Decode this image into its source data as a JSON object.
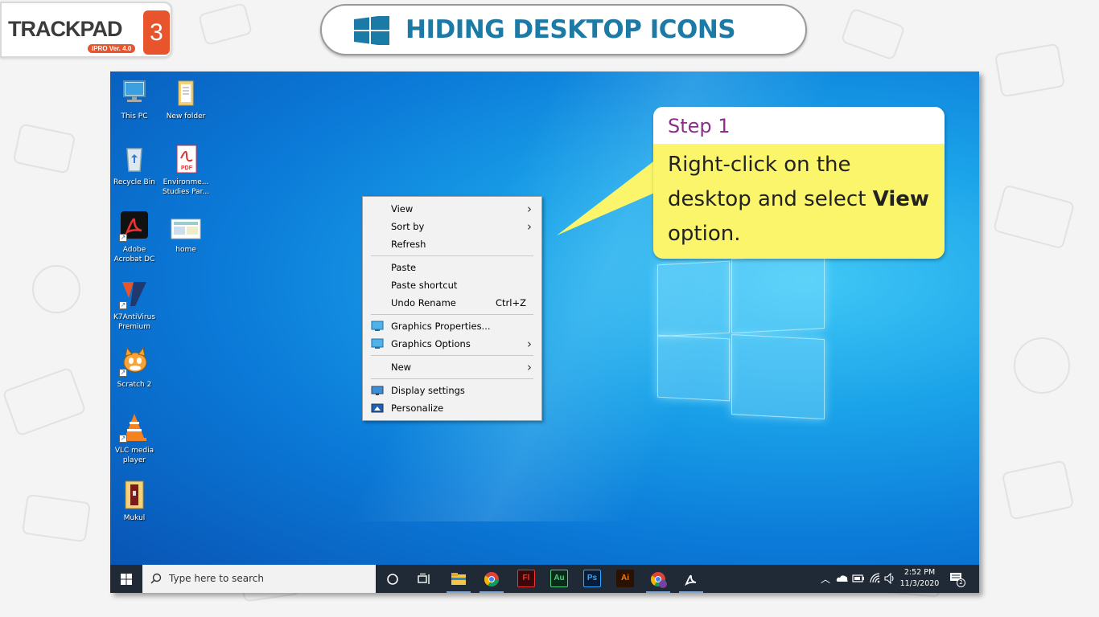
{
  "brand": {
    "name": "TRACKPAD",
    "version": "iPRO Ver. 4.0",
    "number": "3"
  },
  "banner": {
    "title": "HIDING DESKTOP ICONS"
  },
  "desktop_icons": [
    {
      "label": "This PC",
      "icon": "this-pc-icon"
    },
    {
      "label": "New folder",
      "icon": "folder-icon"
    },
    {
      "label": "Recycle Bin",
      "icon": "recycle-bin-icon"
    },
    {
      "label": "Environme... Studies Par...",
      "icon": "pdf-file-icon"
    },
    {
      "label": "Adobe Acrobat DC",
      "icon": "acrobat-icon"
    },
    {
      "label": "home",
      "icon": "image-file-icon"
    },
    {
      "label": "K7AntiVirus Premium",
      "icon": "k7-antivirus-icon"
    },
    {
      "label": "Scratch 2",
      "icon": "scratch-icon"
    },
    {
      "label": "VLC media player",
      "icon": "vlc-icon"
    },
    {
      "label": "Mukul",
      "icon": "archive-icon"
    }
  ],
  "context_menu": {
    "items": [
      {
        "label": "View",
        "submenu": true
      },
      {
        "label": "Sort by",
        "submenu": true
      },
      {
        "label": "Refresh"
      },
      {
        "label": "Paste"
      },
      {
        "label": "Paste shortcut"
      },
      {
        "label": "Undo Rename",
        "shortcut": "Ctrl+Z"
      },
      {
        "label": "Graphics Properties...",
        "icon": "graphics-icon"
      },
      {
        "label": "Graphics Options",
        "icon": "graphics-icon",
        "submenu": true
      },
      {
        "label": "New",
        "submenu": true
      },
      {
        "label": "Display settings",
        "icon": "display-icon"
      },
      {
        "label": "Personalize",
        "icon": "personalize-icon"
      }
    ]
  },
  "callout": {
    "heading": "Step 1",
    "text_before": "Right-click on the desktop and select ",
    "bold": "View",
    "text_after": " option."
  },
  "taskbar": {
    "search_placeholder": "Type here to search",
    "apps": [
      {
        "name": "cortana-icon"
      },
      {
        "name": "task-view-icon"
      },
      {
        "name": "file-explorer-icon"
      },
      {
        "name": "chrome-icon"
      },
      {
        "name": "flash-icon",
        "text": "Fl"
      },
      {
        "name": "audition-icon",
        "text": "Au"
      },
      {
        "name": "photoshop-icon",
        "text": "Ps"
      },
      {
        "name": "illustrator-icon",
        "text": "Ai"
      },
      {
        "name": "chrome-profile-icon"
      },
      {
        "name": "acrobat-taskbar-icon"
      }
    ],
    "time": "2:52 PM",
    "date": "11/3/2020",
    "notifications": "2"
  },
  "colors": {
    "banner_title": "#1c7aa6",
    "brand_orange": "#e8542b",
    "callout_heading": "#8b2f8a",
    "callout_bg": "#faf56a",
    "taskbar": "#202a36"
  }
}
